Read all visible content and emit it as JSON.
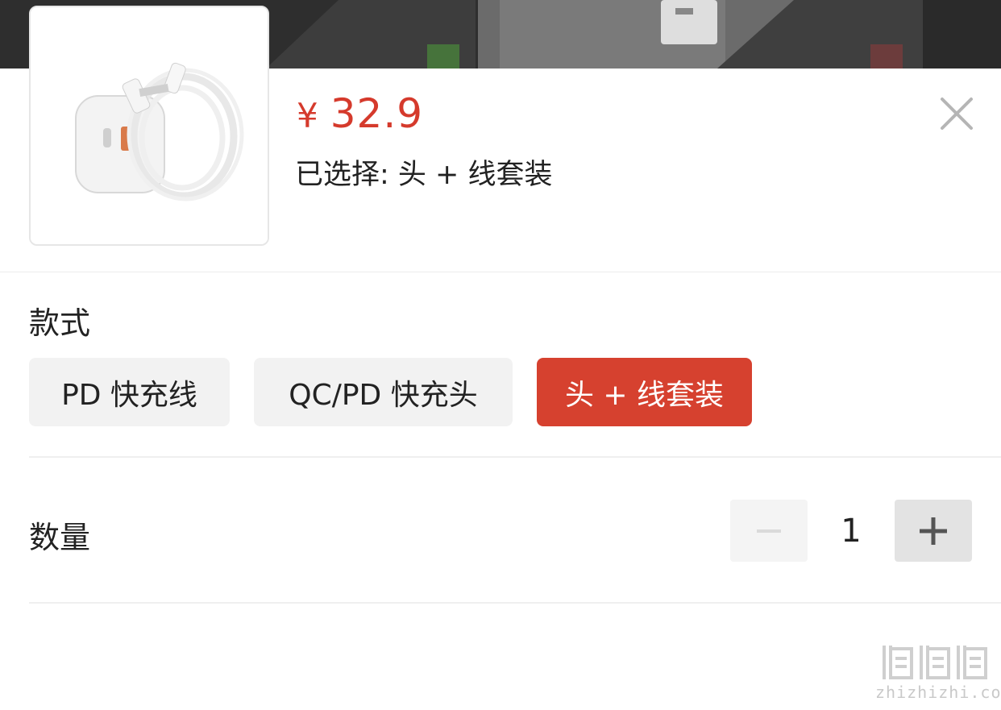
{
  "product": {
    "currency": "¥",
    "price": "32.9",
    "selected_label": "已选择: 头 + 线套装"
  },
  "style_section": {
    "title": "款式",
    "options": [
      {
        "label": "PD 快充线",
        "selected": false
      },
      {
        "label": "QC/PD 快充头",
        "selected": false
      },
      {
        "label": "头 + 线套装",
        "selected": true
      }
    ]
  },
  "quantity_section": {
    "title": "数量",
    "value": "1"
  },
  "watermark": {
    "text": "zhizhizhi.com"
  },
  "colors": {
    "accent": "#d6412f",
    "price": "#d53a2c"
  }
}
